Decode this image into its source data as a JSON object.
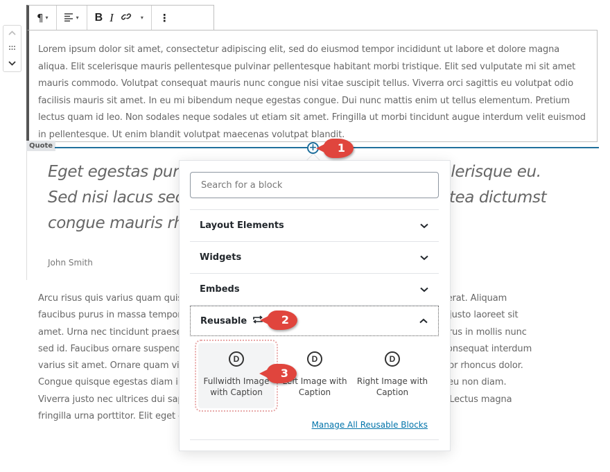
{
  "mover": {
    "up_icon": "chevron-up-icon",
    "drag_icon": "drag-handle-icon",
    "down_icon": "chevron-down-icon"
  },
  "toolbar": {
    "paragraph_icon": "¶",
    "align_icon": "≡",
    "bold_label": "B",
    "italic_label": "I",
    "link_icon": "link-icon",
    "more_icon": "⋮",
    "caret": "▾"
  },
  "paragraph1": {
    "text": "Lorem ipsum dolor sit amet, consectetur adipiscing elit, sed do eiusmod tempor incididunt ut labore et dolore magna aliqua. Elit scelerisque mauris pellentesque pulvinar pellentesque habitant morbi tristique. Elit sed vulputate mi sit amet mauris commodo. Volutpat consequat mauris nunc congue nisi vitae suscipit tellus. Viverra orci sagittis eu volutpat odio facilisis mauris sit amet. In eu mi bibendum neque egestas congue. Dui nunc mattis enim ut tellus elementum. Pretium lectus quam id leo. Non sodales neque sodales ut etiam sit amet. Fringilla ut morbi tincidunt augue interdum velit euismod in pellentesque. Ut enim blandit volutpat maecenas volutpat blandit."
  },
  "quote": {
    "label": "Quote",
    "text": "Eget egestas purus viverra accumsan in nisl nisi scelerisque eu. Sed nisi lacus sed viverra tellus in hac habitasse platea dictumst congue mauris rhoncus aenean.",
    "visible_left": "Eget egestas purus lacus sed viverra te rhoncus aenean.",
    "visible_right": "ue eu. Sed nisi congue mauris",
    "citation": "John Smith"
  },
  "paragraph2": {
    "lines_left": [
      "Arcu risus quis varius quam quis",
      "faucibus purus in massa tempor",
      "amet. Urna nec tincidunt praese",
      "sed id. Faucibus ornare suspend",
      "varius sit amet. Ornare quam viv",
      "Congue quisque egestas diam ir",
      "Viverra justo nec ultrices dui sap",
      "fringilla urna porttitor. Elit eget g"
    ],
    "lines_right": [
      "uam etiam erat. Aliquam",
      "nam libero justo laoreet sit",
      "Amet nisl purus in mollis nunc",
      "cing enim. Consequat interdum",
      "urna porttitor rhoncus dolor.",
      "cum iaculis eu non diam.",
      "t interdum. Lectus magna",
      ""
    ]
  },
  "inserter": {
    "button_icon": "plus-circle-icon",
    "search_placeholder": "Search for a block",
    "search_value": "",
    "panels": [
      {
        "title": "Layout Elements",
        "state": "collapsed"
      },
      {
        "title": "Widgets",
        "state": "collapsed"
      },
      {
        "title": "Embeds",
        "state": "collapsed"
      },
      {
        "title": "Reusable",
        "state": "expanded",
        "icon": "reusable-icon"
      }
    ],
    "reusable_items": [
      {
        "label": "Fullwidth Image with Caption",
        "icon": "D",
        "highlighted": true
      },
      {
        "label": "Left Image with Caption",
        "icon": "D",
        "highlighted": false
      },
      {
        "label": "Right Image with Caption",
        "icon": "D",
        "highlighted": false
      }
    ],
    "manage_link": "Manage All Reusable Blocks"
  },
  "annotations": [
    "1",
    "2",
    "3"
  ],
  "colors": {
    "accent": "#1f6f9c",
    "link": "#0073aa",
    "callout": "#e0453d"
  }
}
